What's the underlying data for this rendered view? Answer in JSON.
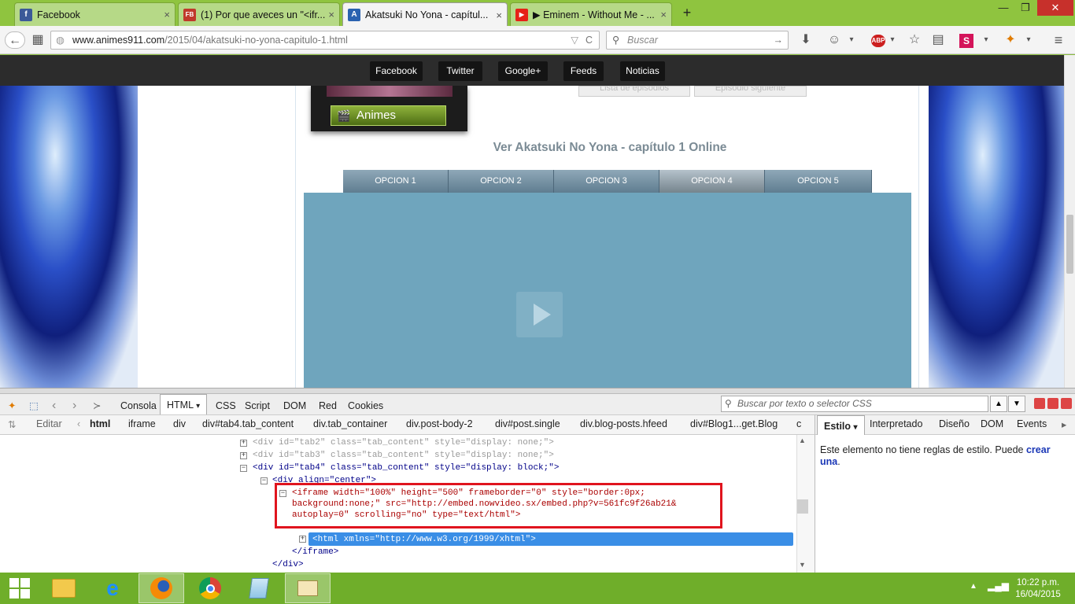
{
  "tabs": [
    {
      "title": "Facebook",
      "close": "×",
      "color": "#3b5998",
      "glyph": "f"
    },
    {
      "title": "(1) Por que aveces un \"<ifr...",
      "close": "×",
      "color": "#c0392b",
      "glyph": "FB"
    },
    {
      "title": "Akatsuki No Yona - capítul...",
      "close": "×",
      "color": "#2a62b0",
      "glyph": "A"
    },
    {
      "title": "▶ Eminem - Without Me - ...",
      "close": "×",
      "color": "#e62117",
      "glyph": "▶"
    }
  ],
  "new_tab": "+",
  "window_buttons": {
    "minimize": "—",
    "maximize": "❐",
    "close": "✕"
  },
  "navbar": {
    "url_host": "www.animes911.com",
    "url_path": "/2015/04/akatsuki-no-yona-capitulo-1.html",
    "search_placeholder": "Buscar",
    "adblock": "ABP"
  },
  "site": {
    "top_buttons": [
      "Facebook",
      "Twitter",
      "Google+",
      "Feeds",
      "Noticias"
    ],
    "episode_prev": "Lista de episodios",
    "episode_next": "Episodio siguiente",
    "animes_label": "Animes",
    "heading": "Ver Akatsuki No Yona - capítulo 1 Online",
    "options": [
      "OPCION 1",
      "OPCION 2",
      "OPCION 3",
      "OPCION 4",
      "OPCION 5"
    ],
    "selected_option": "OPCION 4"
  },
  "firebug": {
    "tabs": [
      "Consola",
      "HTML",
      "CSS",
      "Script",
      "DOM",
      "Red",
      "Cookies"
    ],
    "active_tab": "HTML",
    "search_placeholder": "Buscar por texto o selector CSS",
    "edit_label": "Editar",
    "breadcrumb": [
      "html",
      "iframe",
      "div",
      "div#tab4.tab_content",
      "div.tab_container",
      "div.post-body-2",
      "div#post.single",
      "div.blog-posts.hfeed",
      "div#Blog1...get.Blog",
      "c"
    ],
    "side_tabs": [
      "Estilo",
      "Interpretado",
      "Diseño",
      "DOM",
      "Events"
    ],
    "side_message": "Este elemento no tiene reglas de estilo. Puede ",
    "side_link": "crear una",
    "source": {
      "l1": "<div id=\"tab2\" class=\"tab_content\" style=\"display: none;\">",
      "l2": "<div id=\"tab3\" class=\"tab_content\" style=\"display: none;\">",
      "l3": "<div id=\"tab4\" class=\"tab_content\" style=\"display: block;\">",
      "l4": "<div align=\"center\">",
      "l5": "<iframe width=\"100%\" height=\"500\" frameborder=\"0\" style=\"border:0px;",
      "l6": "background:none;\" src=\"http://embed.nowvideo.sx/embed.php?v=561fc9f26ab21&",
      "l7": "autoplay=0\" scrolling=\"no\" type=\"text/html\">",
      "l8": "<html xmlns=\"http://www.w3.org/1999/xhtml\">",
      "l9": "</iframe>",
      "l10": "</div>"
    }
  },
  "taskbar": {
    "time": "10:22 p.m.",
    "date": "16/04/2015",
    "apps": [
      "file-explorer",
      "internet-explorer",
      "firefox",
      "chrome",
      "notepad",
      "remote-desktop"
    ]
  }
}
